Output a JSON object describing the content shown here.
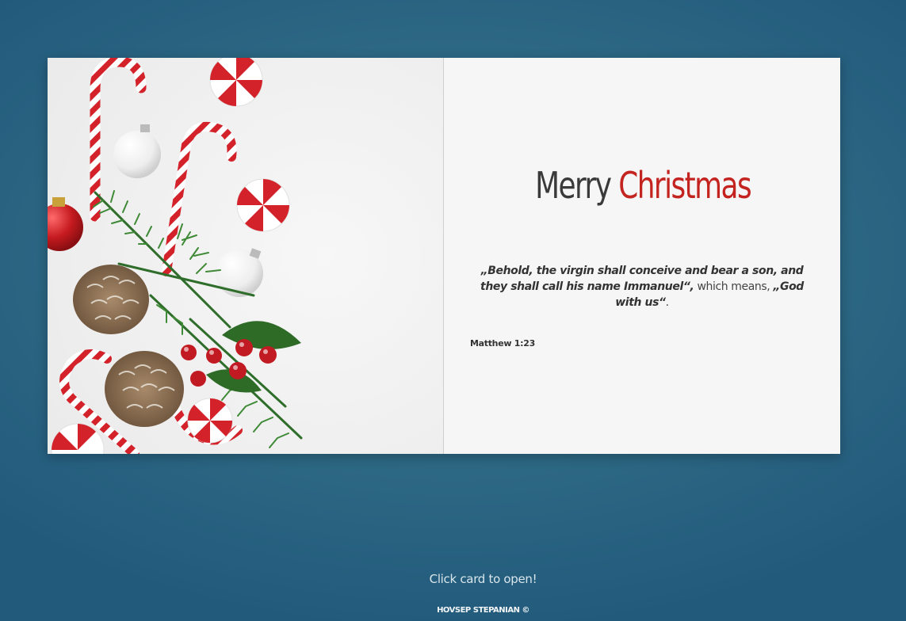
{
  "card": {
    "title_word1": "Merry",
    "title_word2": "Christmas",
    "verse_part1": "„Behold, the virgin shall conceive and bear a son, and they shall call his name Immanuel“,",
    "verse_part2": " which means, ",
    "verse_part3": "„God with us“",
    "verse_part4": ".",
    "reference": "Matthew 1:23",
    "image": "christmas-decorations-image"
  },
  "footer": {
    "hint": "Click card to open!",
    "credit": "HOVSEP STEPANIAN ©"
  },
  "colors": {
    "background": "#2f6b85",
    "accent_red": "#c4241f",
    "title_dark": "#3a3a3a"
  }
}
